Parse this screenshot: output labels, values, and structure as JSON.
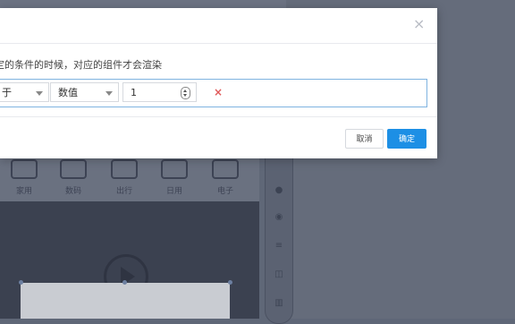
{
  "background": {
    "categories": [
      "家用",
      "数码",
      "出行",
      "日用",
      "电子"
    ],
    "help_glyph": "?"
  },
  "dialog": {
    "close_glyph": "×",
    "description": "定的条件的时候，对应的组件才会渲染",
    "condition": {
      "operator_value": "于",
      "type_value": "数值",
      "number_value": "1",
      "remove_glyph": "×"
    },
    "cancel_label": "取消",
    "confirm_label": "确定"
  },
  "colors": {
    "primary": "#1d8fe5",
    "overlay": "#5f6777",
    "remove": "#e05a5a"
  }
}
